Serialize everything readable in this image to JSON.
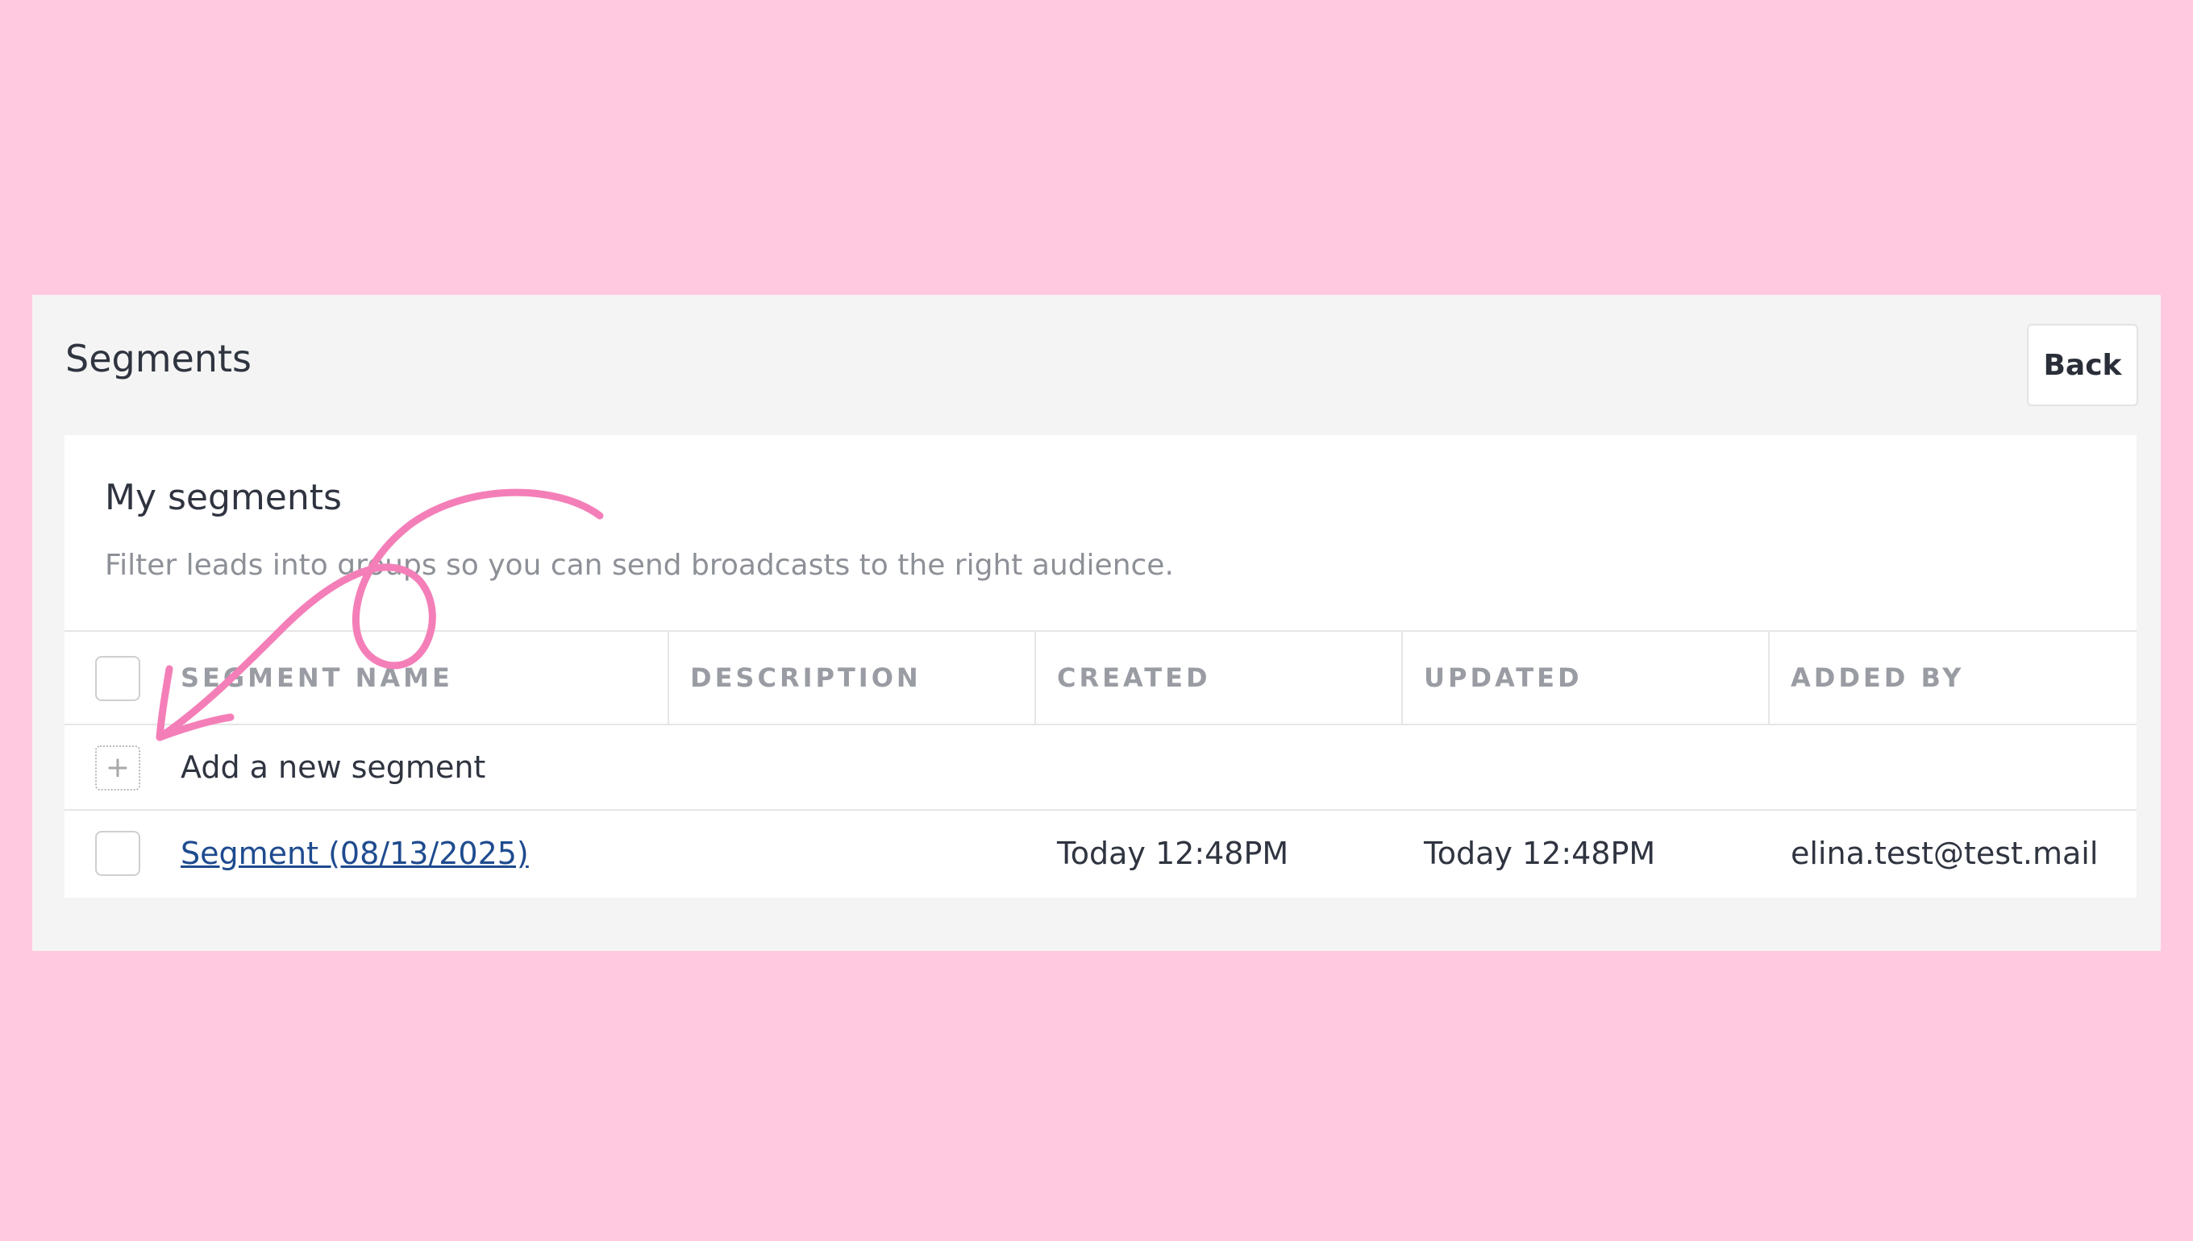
{
  "page": {
    "title": "Segments",
    "back_label": "Back"
  },
  "card": {
    "title": "My segments",
    "subtitle": "Filter leads into groups so you can send broadcasts to the right audience."
  },
  "table": {
    "columns": [
      "SEGMENT NAME",
      "DESCRIPTION",
      "CREATED",
      "UPDATED",
      "ADDED BY"
    ],
    "add_row": {
      "icon": "plus-icon",
      "glyph": "+",
      "label": "Add a new segment"
    },
    "rows": [
      {
        "name": "Segment (08/13/2025)",
        "description": "",
        "created": "Today 12:48PM",
        "updated": "Today 12:48PM",
        "added_by": "elina.test@test.mail"
      }
    ]
  },
  "colors": {
    "background": "#ffcae0",
    "panel": "#f4f4f4",
    "link": "#1f4b8f",
    "annotation_arrow": "#f47fb8"
  }
}
